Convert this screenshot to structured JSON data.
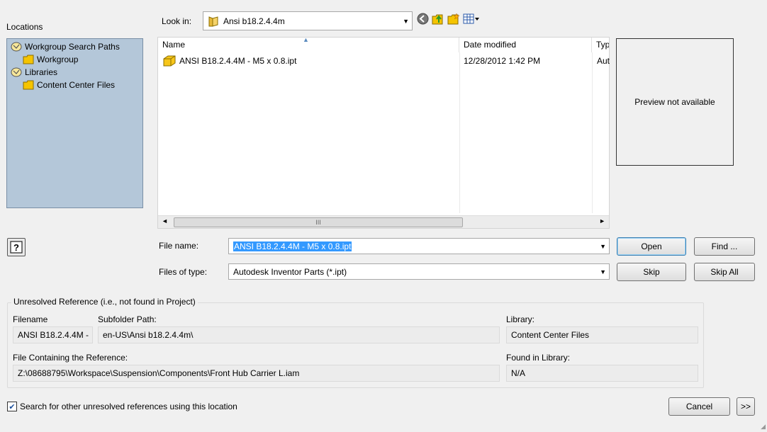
{
  "locations": {
    "title": "Locations",
    "items": [
      {
        "label": "Workgroup Search Paths",
        "icon": "search-paths-icon",
        "level": 0
      },
      {
        "label": "Workgroup",
        "icon": "folder-icon",
        "level": 1
      },
      {
        "label": "Libraries",
        "icon": "library-icon",
        "level": 0
      },
      {
        "label": "Content Center Files",
        "icon": "folder-icon",
        "level": 1
      }
    ]
  },
  "look_in": {
    "label": "Look in:",
    "value": "Ansi b18.2.4.4m"
  },
  "file_list": {
    "columns": [
      "Name",
      "Date modified",
      "Typ"
    ],
    "rows": [
      {
        "name": "ANSI B18.2.4.4M - M5 x 0.8.ipt",
        "date": "12/28/2012 1:42 PM",
        "type": "Aut"
      }
    ]
  },
  "preview": {
    "text": "Preview not available"
  },
  "file_name": {
    "label": "File name:",
    "value": "ANSI B18.2.4.4M - M5 x 0.8.ipt"
  },
  "files_of_type": {
    "label": "Files of type:",
    "value": "Autodesk Inventor Parts (*.ipt)"
  },
  "buttons": {
    "open": "Open",
    "find": "Find ...",
    "skip": "Skip",
    "skip_all": "Skip All",
    "cancel": "Cancel",
    "more": ">>"
  },
  "unresolved": {
    "title": "Unresolved Reference (i.e., not found in Project)",
    "filename_label": "Filename",
    "filename_value": "ANSI B18.2.4.4M -",
    "subfolder_label": "Subfolder Path:",
    "subfolder_value": "en-US\\Ansi b18.2.4.4m\\",
    "library_label": "Library:",
    "library_value": "Content Center Files",
    "containing_label": "File Containing the Reference:",
    "containing_value": "Z:\\08688795\\Workspace\\Suspension\\Components\\Front Hub Carrier L.iam",
    "found_label": "Found in Library:",
    "found_value": "N/A"
  },
  "search_option": {
    "label": "Search for other unresolved references using this location",
    "checked": true
  },
  "colors": {
    "selection": "#3399ff",
    "locations_bg": "#b4c7d9",
    "folder": "#f5c400"
  }
}
